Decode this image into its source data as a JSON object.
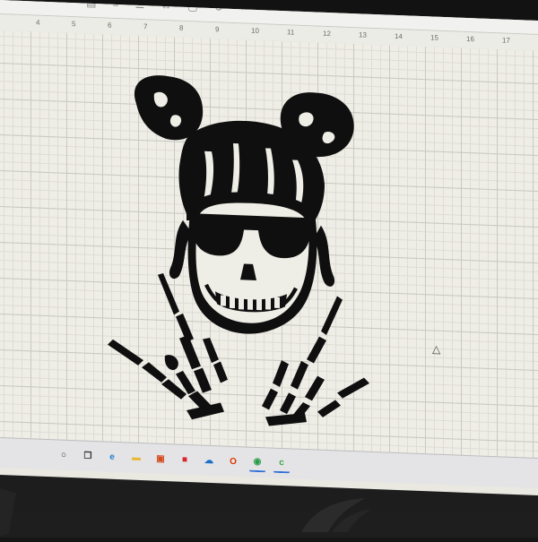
{
  "app": {
    "toolbar": {
      "items": [
        {
          "icon": "undo-icon",
          "glyph": "↶"
        },
        {
          "icon": "redo-icon",
          "glyph": "↷"
        },
        {
          "icon": "arrange-icon",
          "glyph": "▤"
        },
        {
          "icon": "align-icon",
          "glyph": "≡"
        },
        {
          "icon": "distribute-icon",
          "glyph": "☰"
        },
        {
          "icon": "flip-icon",
          "glyph": "↔"
        },
        {
          "icon": "size-icon",
          "glyph": "▢"
        },
        {
          "icon": "rotate-icon",
          "glyph": "↻"
        },
        {
          "icon": "position-icon",
          "glyph": "⌖"
        }
      ]
    },
    "ruler": {
      "numbers": [
        "4",
        "5",
        "6",
        "7",
        "8",
        "9",
        "10",
        "11",
        "12",
        "13",
        "14",
        "15",
        "16",
        "17"
      ]
    },
    "canvas": {
      "design_name": "skull-girl-messy-bun-rock-hands",
      "fill_color": "#0f0f0f",
      "grid_color": "#c9c8c1",
      "background_color": "#eeede6"
    }
  },
  "taskbar": {
    "icons": [
      {
        "name": "search-icon",
        "glyph": "○",
        "color": "#333333"
      },
      {
        "name": "task-view-icon",
        "glyph": "❐",
        "color": "#333333"
      },
      {
        "name": "edge-browser-icon",
        "glyph": "e",
        "color": "#1f7fd1"
      },
      {
        "name": "file-explorer-icon",
        "glyph": "▬",
        "color": "#e8b930"
      },
      {
        "name": "store-icon",
        "glyph": "▣",
        "color": "#d34b1e"
      },
      {
        "name": "gift-app-icon",
        "glyph": "■",
        "color": "#d9262c"
      },
      {
        "name": "onedrive-icon",
        "glyph": "☁",
        "color": "#1a6fc9"
      },
      {
        "name": "office-icon",
        "glyph": "O",
        "color": "#d83b01"
      },
      {
        "name": "chrome-icon",
        "glyph": "◉",
        "color": "#2a9d48"
      },
      {
        "name": "cricut-design-space-icon",
        "glyph": "c",
        "color": "#3ca64a"
      }
    ]
  },
  "monitor": {
    "brand_logo": "rog-logo"
  }
}
